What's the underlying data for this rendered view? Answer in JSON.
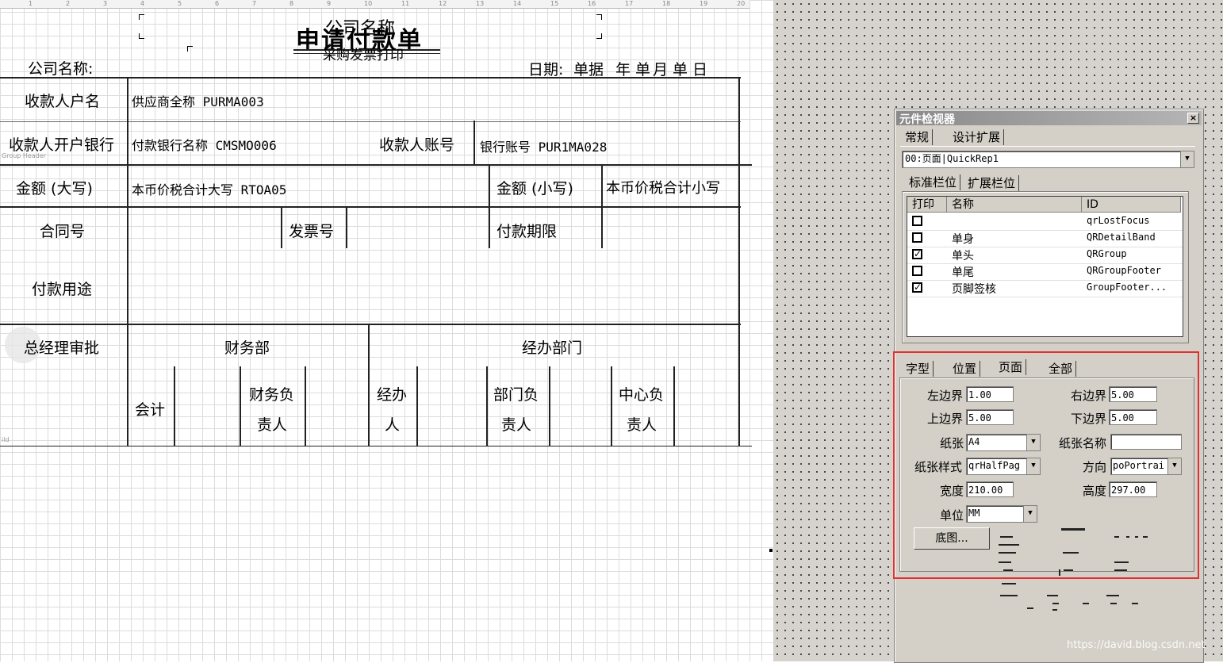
{
  "report": {
    "ruler": [
      "1",
      "2",
      "3",
      "4",
      "5",
      "6",
      "7",
      "8",
      "9",
      "10",
      "11",
      "12",
      "13",
      "14",
      "15",
      "16",
      "17",
      "18",
      "19",
      "20"
    ],
    "title_company": "公司名称",
    "title_main": "申请付款单",
    "title_sub": "采购发票打印",
    "company_label": "公司名称:",
    "date_label": "日期:",
    "date_year_field": "单据",
    "date_year": "年",
    "date_month_field": "单",
    "date_month": "月",
    "date_day_field": "单",
    "date_day": "日",
    "payee_label": "收款人户名",
    "payee_field": "供应商全称 PURMA003",
    "bank_label": "收款人开户银行",
    "bank_field": "付款银行名称 CMSMO006",
    "account_label": "收款人账号",
    "account_field": "银行账号 PUR1MA028",
    "band_group_header": "Group Header",
    "amount_upper_label": "金额 (大写)",
    "amount_upper_field": "本币价税合计大写 RTOA05",
    "amount_lower_label": "金额 (小写)",
    "amount_lower_field": "本币价税合计小写",
    "contract_label": "合同号",
    "invoice_label": "发票号",
    "term_label": "付款期限",
    "purpose_label": "付款用途",
    "gm_label": "总经理审批",
    "finance_label": "财务部",
    "dept_label": "经办部门",
    "accountant_label": "会计",
    "finance_head_1": "财务负",
    "finance_head_2": "责人",
    "handler_1": "经办",
    "handler_2": "人",
    "dept_head_1": "部门负",
    "dept_head_2": "责人",
    "center_head_1": "中心负",
    "center_head_2": "责人",
    "band_footer": "ild"
  },
  "inspector": {
    "title": "元件检视器",
    "close": "×",
    "tabs": [
      "常规",
      "设计扩展"
    ],
    "selector": "00:页面|QuickRep1",
    "subtabs": [
      "标准栏位",
      "扩展栏位"
    ],
    "columns": [
      "打印",
      "名称",
      "ID"
    ],
    "rows": [
      {
        "checked": false,
        "name": "",
        "id": "qrLostFocus"
      },
      {
        "checked": false,
        "name": "单身",
        "id": "QRDetailBand"
      },
      {
        "checked": true,
        "name": "单头",
        "id": "QRGroup"
      },
      {
        "checked": false,
        "name": "单尾",
        "id": "QRGroupFooter"
      },
      {
        "checked": true,
        "name": "页脚签核",
        "id": "GroupFooter..."
      }
    ],
    "prop_tabs": [
      "字型",
      "位置",
      "页面",
      "全部"
    ],
    "left_margin_label": "左边界",
    "left_margin": "1.00",
    "right_margin_label": "右边界",
    "right_margin": "5.00",
    "top_margin_label": "上边界",
    "top_margin": "5.00",
    "bottom_margin_label": "下边界",
    "bottom_margin": "5.00",
    "paper_label": "纸张",
    "paper": "A4",
    "paper_name_label": "纸张名称",
    "paper_name": "",
    "paper_style_label": "纸张样式",
    "paper_style": "qrHalfPag",
    "orientation_label": "方向",
    "orientation": "poPortrai",
    "width_label": "宽度",
    "width": "210.00",
    "height_label": "高度",
    "height": "297.00",
    "unit_label": "单位",
    "unit": "MM",
    "background_button": "底图..."
  },
  "watermark": "https://david.blog.csdn.net"
}
